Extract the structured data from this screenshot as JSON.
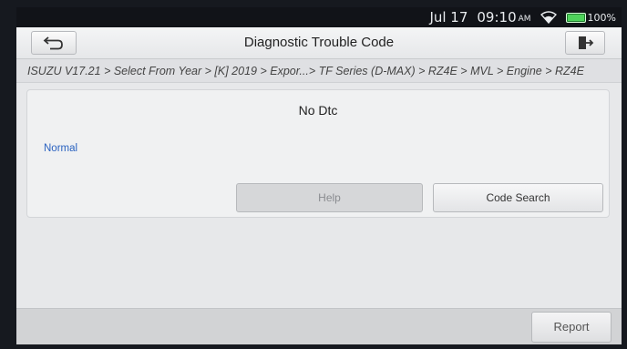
{
  "status_bar": {
    "date": "Jul 17",
    "time": "09:10",
    "ampm": "AM",
    "battery": "100%",
    "battery_level": 1.0,
    "wifi_icon": "wifi-icon"
  },
  "header": {
    "title": "Diagnostic Trouble Code",
    "back_icon": "back-arrow-icon",
    "exit_icon": "exit-icon"
  },
  "breadcrumb": "ISUZU V17.21 > Select From Year > [K] 2019 > Expor...> TF Series (D-MAX) > RZ4E > MVL > Engine > RZ4E",
  "main": {
    "message": "No Dtc",
    "status": "Normal",
    "help_label": "Help",
    "code_search_label": "Code Search"
  },
  "footer": {
    "report_label": "Report"
  },
  "colors": {
    "status_text": "#2a62c0",
    "battery_green": "#4fd35b"
  }
}
